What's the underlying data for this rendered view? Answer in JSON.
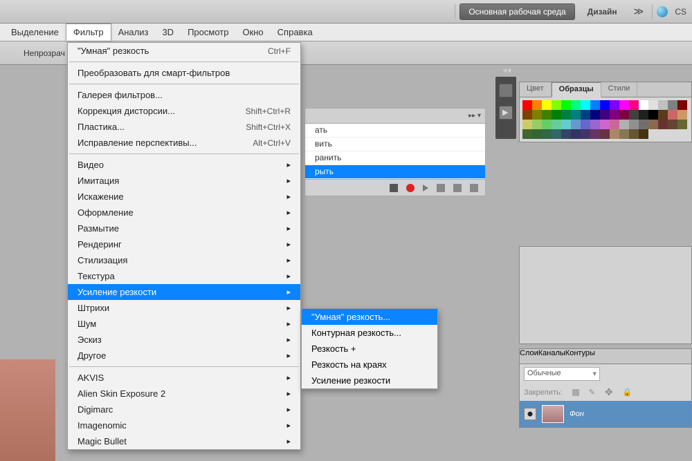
{
  "topbar": {
    "workspace_button": "Основная рабочая среда",
    "design_label": "Дизайн",
    "cs_label": "CS"
  },
  "menubar": {
    "items": [
      "Выделение",
      "Фильтр",
      "Анализ",
      "3D",
      "Просмотр",
      "Окно",
      "Справка"
    ],
    "active_index": 1
  },
  "optionsbar": {
    "opacity_label": "Непрозрач"
  },
  "filter_menu": {
    "smart_sharpen": "\"Умная\" резкость",
    "smart_sharpen_shortcut": "Ctrl+F",
    "convert_smart": "Преобразовать для смарт-фильтров",
    "gallery": "Галерея фильтров...",
    "lens_correction": "Коррекция дисторсии...",
    "lens_correction_shortcut": "Shift+Ctrl+R",
    "liquify": "Пластика...",
    "liquify_shortcut": "Shift+Ctrl+X",
    "vanishing": "Исправление перспективы...",
    "vanishing_shortcut": "Alt+Ctrl+V",
    "video": "Видео",
    "artistic": "Имитация",
    "distort": "Искажение",
    "stylize_ofm": "Оформление",
    "blur": "Размытие",
    "render": "Рендеринг",
    "stylize": "Стилизация",
    "texture": "Текстура",
    "sharpen": "Усиление резкости",
    "brush": "Штрихи",
    "noise": "Шум",
    "sketch": "Эскиз",
    "other": "Другое",
    "akvis": "AKVIS",
    "alien": "Alien Skin Exposure 2",
    "digimarc": "Digimarc",
    "imagenomic": "Imagenomic",
    "magicbullet": "Magic Bullet"
  },
  "sharpen_submenu": {
    "items": [
      "\"Умная\" резкость...",
      "Контурная резкость...",
      "Резкость +",
      "Резкость на краях",
      "Усиление резкости"
    ],
    "highlight_index": 0
  },
  "actions_panel": {
    "items": [
      "ать",
      "вить",
      "ранить",
      "рыть"
    ],
    "selected_index": 3
  },
  "swatch_tabs": {
    "color": "Цвет",
    "swatches": "Образцы",
    "styles": "Стили"
  },
  "layers_panel": {
    "tabs": {
      "layers": "Слои",
      "channels": "Каналы",
      "paths": "Контуры"
    },
    "blend_mode": "Обычные",
    "lock_label": "Закрепить:",
    "layer_name": "Фон"
  },
  "swatch_colors": [
    "#ff0000",
    "#ff8000",
    "#ffff00",
    "#80ff00",
    "#00ff00",
    "#00ff80",
    "#00ffff",
    "#0080ff",
    "#0000ff",
    "#8000ff",
    "#ff00ff",
    "#ff0080",
    "#ffffff",
    "#e0e0e0",
    "#c0c0c0",
    "#808080",
    "#800000",
    "#804000",
    "#808000",
    "#408000",
    "#008000",
    "#008040",
    "#008080",
    "#004080",
    "#000080",
    "#400080",
    "#800080",
    "#800040",
    "#404040",
    "#202020",
    "#000000",
    "#5a3a1a",
    "#cc6666",
    "#cc9966",
    "#cccc66",
    "#99cc66",
    "#66cc66",
    "#66cc99",
    "#66cccc",
    "#6699cc",
    "#6666cc",
    "#9966cc",
    "#cc66cc",
    "#cc6699",
    "#b0b0b0",
    "#909090",
    "#707070",
    "#8a6a4a",
    "#663333",
    "#664433",
    "#666633",
    "#446633",
    "#336633",
    "#336644",
    "#336666",
    "#334466",
    "#333366",
    "#443366",
    "#663366",
    "#663344",
    "#aa8866",
    "#887755",
    "#665533",
    "#443311"
  ]
}
